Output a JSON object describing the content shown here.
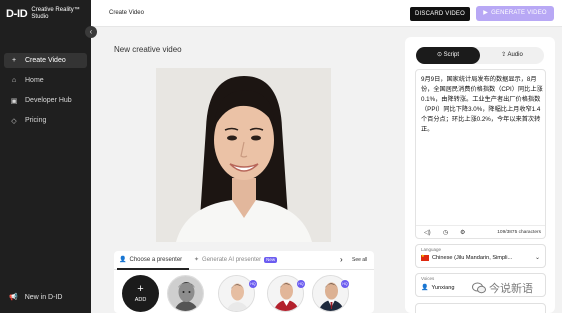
{
  "sidebar": {
    "logo": "D-ID",
    "brand_line1": "Creative Reality™",
    "brand_line2": "Studio",
    "collapse_icon": "chevron-left-icon",
    "items": [
      {
        "label": "Create Video",
        "icon": "plus-icon",
        "active": true
      },
      {
        "label": "Home",
        "icon": "home-icon",
        "active": false
      },
      {
        "label": "Developer Hub",
        "icon": "code-icon",
        "active": false
      },
      {
        "label": "Pricing",
        "icon": "tag-icon",
        "active": false
      }
    ],
    "footer_label": "New in D-ID",
    "footer_icon": "megaphone-icon"
  },
  "topbar": {
    "title": "Create Video",
    "discard_label": "DISCARD VIDEO",
    "generate_label": "GENERATE VIDEO",
    "generate_color": "#b8a8f5"
  },
  "main": {
    "heading": "New creative video",
    "presenter_tabs": {
      "choose_label": "Choose a presenter",
      "genai_label": "Generate AI presenter",
      "new_badge": "New",
      "see_all": "See all"
    },
    "add_label": "ADD",
    "hq_badge": "HQ"
  },
  "panel": {
    "tabs": {
      "script": "Script",
      "audio": "Audio"
    },
    "script_text": "9月9日，国家统计局发布的数据显示，8月份，全国居民消费价格指数（CPI）同比上涨0.1%，由降转涨。工业生产者出厂价格指数（PPI）同比下降3.0%，降幅比上月收窄1.4个百分点；环比上涨0.2%，今年以来首次转正。",
    "char_count": "109/3875 characters",
    "language_label": "Language",
    "language_value": "Chinese (Jilu Mandarin, Simpli...",
    "voices_label": "Voices",
    "voice_value": "Yunxiang"
  },
  "watermark": {
    "text": "今说新语"
  }
}
